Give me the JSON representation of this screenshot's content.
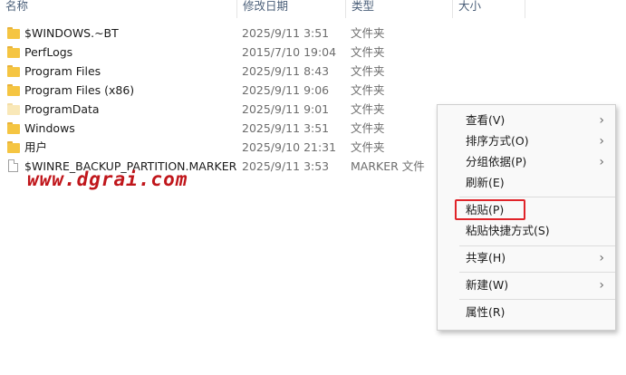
{
  "columns": {
    "name": "名称",
    "date": "修改日期",
    "type": "类型",
    "size": "大小"
  },
  "files": [
    {
      "name": "$WINDOWS.~BT",
      "date": "2025/9/11 3:51",
      "type": "文件夹",
      "icon": "folder-icon",
      "faded": false
    },
    {
      "name": "PerfLogs",
      "date": "2015/7/10 19:04",
      "type": "文件夹",
      "icon": "folder-icon",
      "faded": false
    },
    {
      "name": "Program Files",
      "date": "2025/9/11 8:43",
      "type": "文件夹",
      "icon": "folder-icon",
      "faded": false
    },
    {
      "name": "Program Files (x86)",
      "date": "2025/9/11 9:06",
      "type": "文件夹",
      "icon": "folder-icon",
      "faded": false
    },
    {
      "name": "ProgramData",
      "date": "2025/9/11 9:01",
      "type": "文件夹",
      "icon": "folder-icon",
      "faded": true
    },
    {
      "name": "Windows",
      "date": "2025/9/11 3:51",
      "type": "文件夹",
      "icon": "folder-icon",
      "faded": false
    },
    {
      "name": "用户",
      "date": "2025/9/10 21:31",
      "type": "文件夹",
      "icon": "folder-icon",
      "faded": false
    },
    {
      "name": "$WINRE_BACKUP_PARTITION.MARKER",
      "date": "2025/9/11 3:53",
      "type": "MARKER 文件",
      "icon": "file-icon",
      "faded": false
    }
  ],
  "watermark": "www.dgrai.com",
  "context_menu": {
    "view": "查看(V)",
    "sort": "排序方式(O)",
    "group": "分组依据(P)",
    "refresh": "刷新(E)",
    "paste": "粘贴(P)",
    "paste_shortcut": "粘贴快捷方式(S)",
    "share": "共享(H)",
    "new": "新建(W)",
    "properties": "属性(R)"
  },
  "colors": {
    "folder": "#f5c542",
    "highlight_box": "#e0242a",
    "watermark": "#c0161b"
  }
}
